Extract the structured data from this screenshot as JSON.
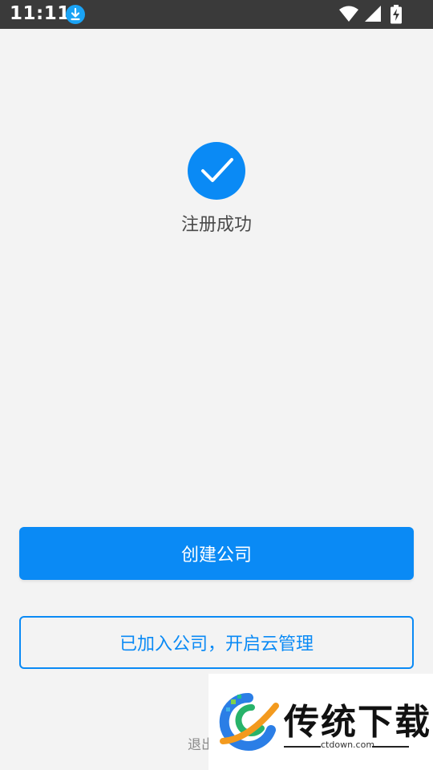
{
  "status_bar": {
    "time": "11:11",
    "icons": [
      "download-icon",
      "wifi-icon",
      "cell-signal-icon",
      "battery-charging-icon"
    ]
  },
  "main": {
    "success_icon": "check-circle-icon",
    "success_text": "注册成功"
  },
  "buttons": {
    "create_company": "创建公司",
    "joined_company": "已加入公司，开启云管理"
  },
  "logout": {
    "label_visible": "退出"
  },
  "watermark": {
    "title": "传统下载",
    "url": "ctdown.com"
  },
  "colors": {
    "accent": "#0a8af5",
    "status_bar": "#3a3a3a",
    "background": "#f3f3f3"
  }
}
